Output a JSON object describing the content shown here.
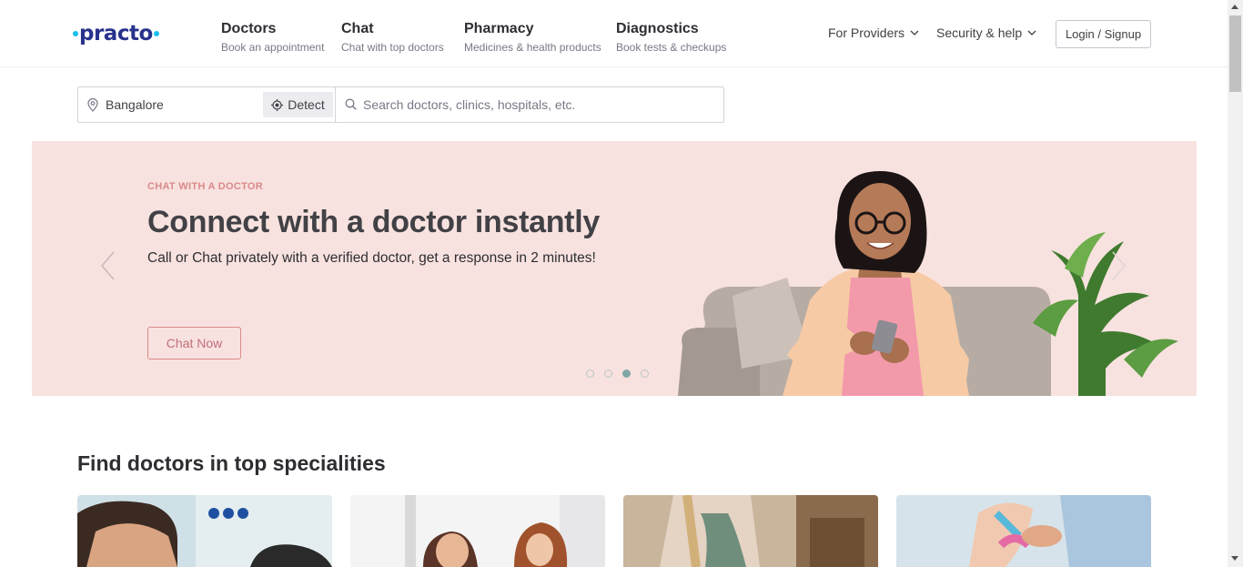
{
  "header": {
    "logo_text": "practo",
    "nav": [
      {
        "title": "Doctors",
        "subtitle": "Book an appointment"
      },
      {
        "title": "Chat",
        "subtitle": "Chat with top doctors"
      },
      {
        "title": "Pharmacy",
        "subtitle": "Medicines & health products"
      },
      {
        "title": "Diagnostics",
        "subtitle": "Book tests & checkups"
      }
    ],
    "for_providers": "For Providers",
    "security_help": "Security & help",
    "login": "Login / Signup"
  },
  "search": {
    "location": "Bangalore",
    "detect_label": "Detect",
    "placeholder": "Search doctors, clinics, hospitals, etc."
  },
  "hero": {
    "eyebrow": "CHAT WITH A DOCTOR",
    "title": "Connect with a doctor instantly",
    "subtitle": "Call or Chat privately with a verified doctor, get a response in 2 minutes!",
    "cta": "Chat Now",
    "slide_count": 4,
    "active_slide": 3
  },
  "specialities": {
    "title": "Find doctors in top specialities"
  },
  "colors": {
    "brand_navy": "#28328c",
    "brand_blue": "#14bef0",
    "hero_bg": "#f8e2df",
    "accent_rose": "#d98a8a"
  }
}
